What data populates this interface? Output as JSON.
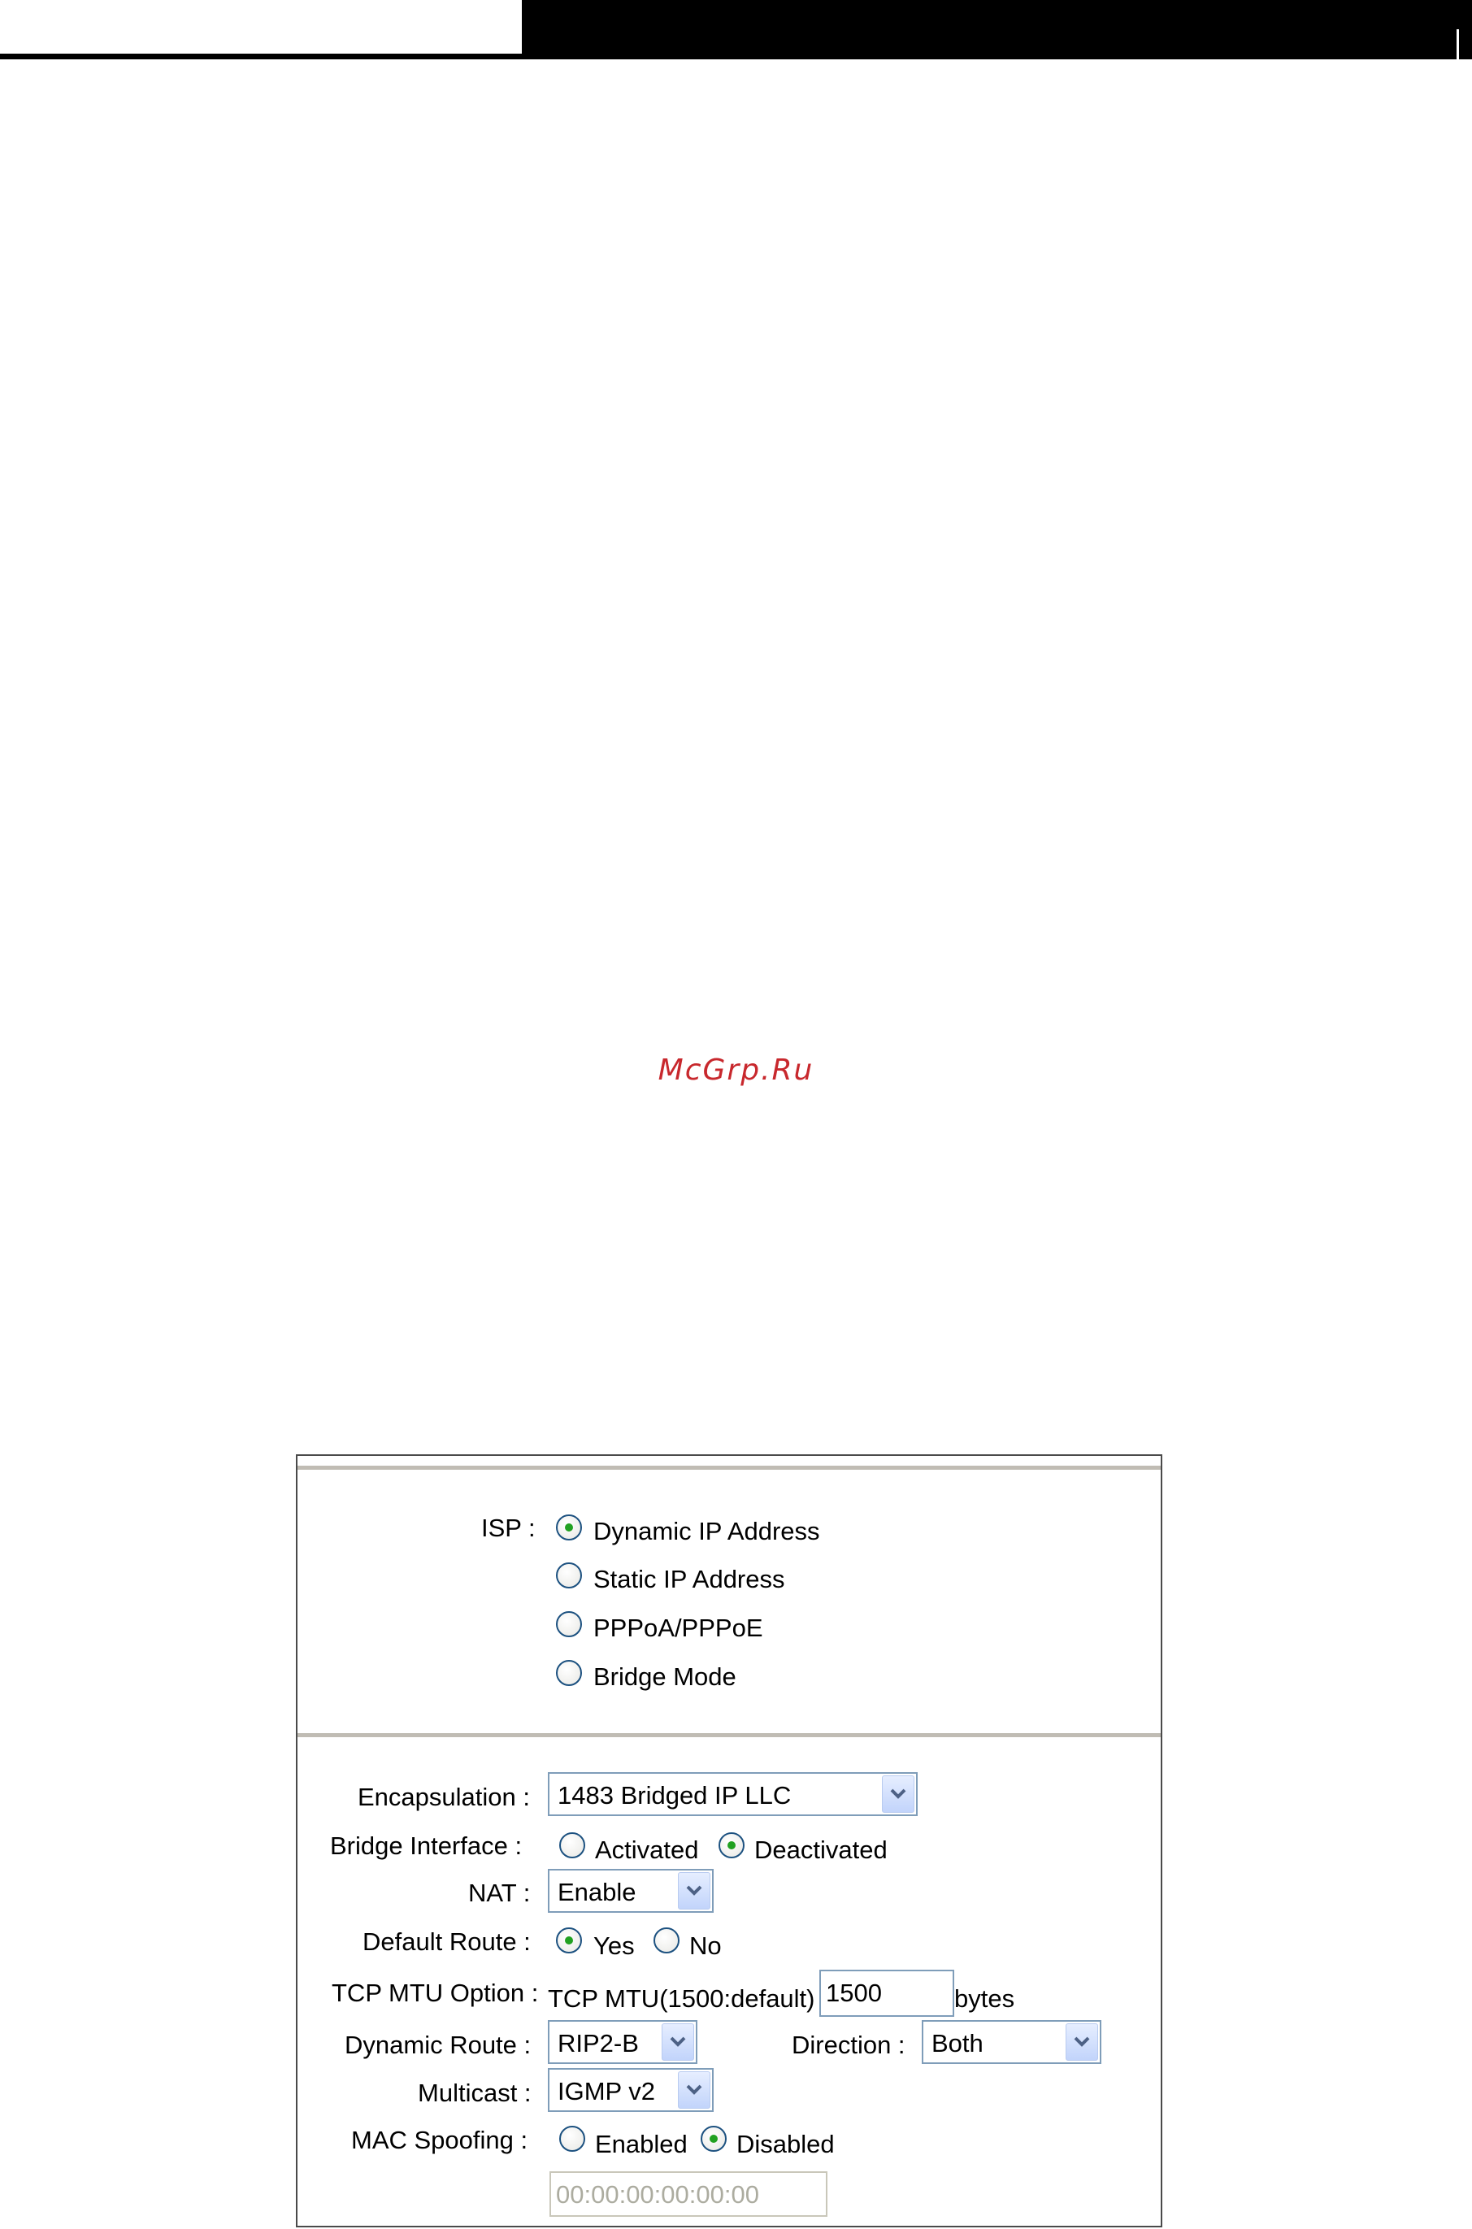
{
  "watermark": "McGrp.Ru",
  "isp": {
    "label": "ISP :",
    "options": [
      "Dynamic IP Address",
      "Static IP Address",
      "PPPoA/PPPoE",
      "Bridge Mode"
    ],
    "selected": "Dynamic IP Address"
  },
  "encapsulation": {
    "label": "Encapsulation :",
    "value": "1483 Bridged IP LLC"
  },
  "bridge_interface": {
    "label": "Bridge Interface :",
    "options": [
      "Activated",
      "Deactivated"
    ],
    "selected": "Deactivated"
  },
  "nat": {
    "label": "NAT :",
    "value": "Enable"
  },
  "default_route": {
    "label": "Default Route :",
    "options": [
      "Yes",
      "No"
    ],
    "selected": "Yes"
  },
  "tcp_mtu": {
    "label": "TCP MTU Option :",
    "prefix": "TCP MTU(1500:default)",
    "value": "1500",
    "unit": "bytes"
  },
  "dynamic_route": {
    "label": "Dynamic Route :",
    "value": "RIP2-B"
  },
  "direction": {
    "label": "Direction :",
    "value": "Both"
  },
  "multicast": {
    "label": "Multicast :",
    "value": "IGMP v2"
  },
  "mac_spoofing": {
    "label": "MAC Spoofing :",
    "options": [
      "Enabled",
      "Disabled"
    ],
    "selected": "Disabled",
    "mac_value": "00:00:00:00:00:00"
  },
  "colors": {
    "watermark": "#c8282d",
    "radio_dot": "#21a121",
    "field_border": "#7f9db9",
    "separator": "#c0bcb4"
  }
}
